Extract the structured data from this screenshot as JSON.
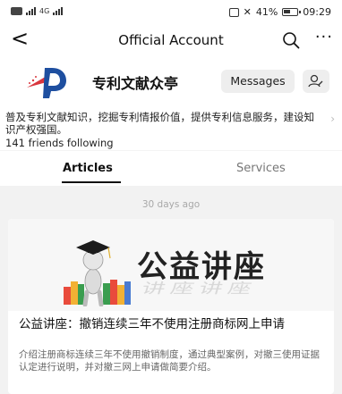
{
  "status_bar": {
    "network_label": "4G",
    "battery_percent": "41%",
    "time": "09:29"
  },
  "nav": {
    "back_icon": "chevron-left-icon",
    "title": "Official Account",
    "search_icon": "search-icon",
    "more_icon": "more-icon",
    "back_glyph": "<",
    "more_glyph": "···"
  },
  "account": {
    "name": "专利文献众亭",
    "messages_label": "Messages",
    "follow_icon": "profile-icon",
    "description": "普及专利文献知识，挖掘专利情报价值，提供专利信息服务，建设知识产权强国。",
    "followers": "141 friends following",
    "brand_red": "#d9363e",
    "brand_blue": "#1e4fa0"
  },
  "tabs": [
    {
      "label": "Articles",
      "active": true
    },
    {
      "label": "Services",
      "active": false
    }
  ],
  "feed": {
    "date": "30 days ago",
    "article": {
      "cover_text": "公益讲座",
      "title": "公益讲座：撤销连续三年不使用注册商标网上申请",
      "summary": "介绍注册商标连续三年不使用撤销制度，通过典型案例，对撤三使用证据认定进行说明，并对撤三网上申请做简要介绍。"
    }
  }
}
